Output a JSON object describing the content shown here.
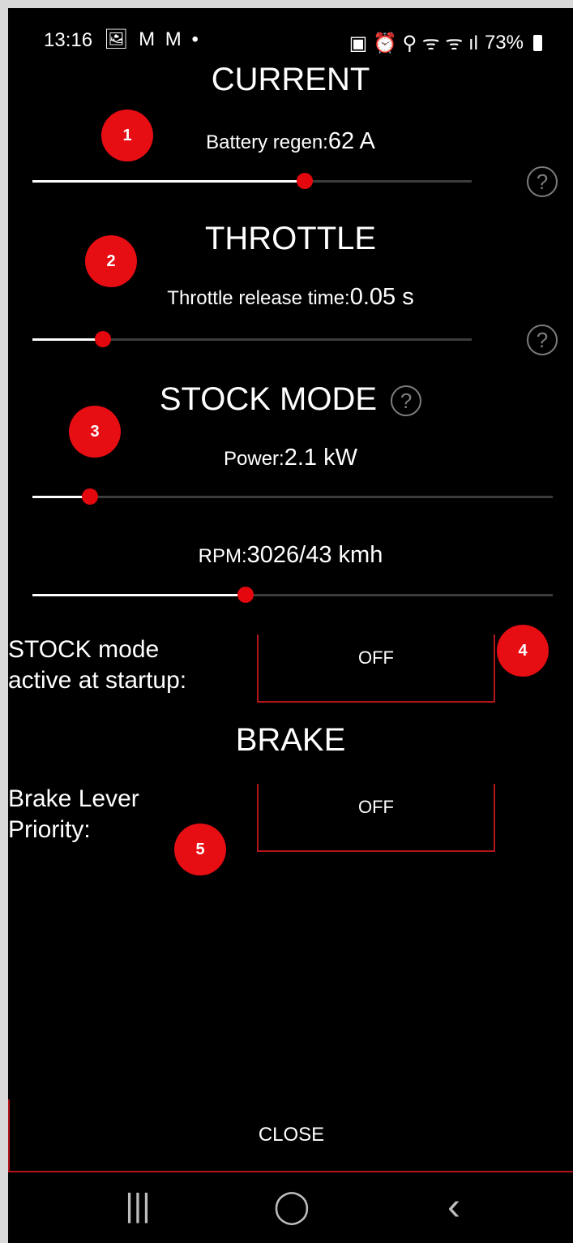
{
  "status_bar": {
    "time": "13:16",
    "left_icons": "🖼 M M •",
    "right_icons": "▣ ⏰ ⚲ ᯤ ᯤ ıl",
    "battery": "73%"
  },
  "sections": {
    "current": {
      "title": "CURRENT",
      "label": "Battery regen:",
      "value": "62 A",
      "slider_fraction": 0.62
    },
    "throttle": {
      "title": "THROTTLE",
      "label": "Throttle release time:",
      "value": "0.05 s",
      "slider_fraction": 0.16
    },
    "stock_mode": {
      "title": "STOCK MODE",
      "power_label": "Power:",
      "power_value": "2.1 kW",
      "power_fraction": 0.11,
      "rpm_label": "RPM:",
      "rpm_value": "3026/43 kmh",
      "rpm_fraction": 0.41,
      "startup_label_line1": "STOCK mode",
      "startup_label_line2": "active at startup:",
      "startup_toggle": "OFF"
    },
    "brake": {
      "title": "BRAKE",
      "priority_label_line1": "Brake Lever",
      "priority_label_line2": "Priority:",
      "priority_toggle": "OFF"
    }
  },
  "help_glyph": "?",
  "annotations": [
    "1",
    "2",
    "3",
    "4",
    "5"
  ],
  "close_label": "CLOSE",
  "nav": {
    "recents": "|||",
    "home": "◯",
    "back": "‹"
  },
  "colors": {
    "accent_red": "#e4070d",
    "badge_red": "#e60d13",
    "border_red": "#b3141a",
    "background": "#000000"
  }
}
